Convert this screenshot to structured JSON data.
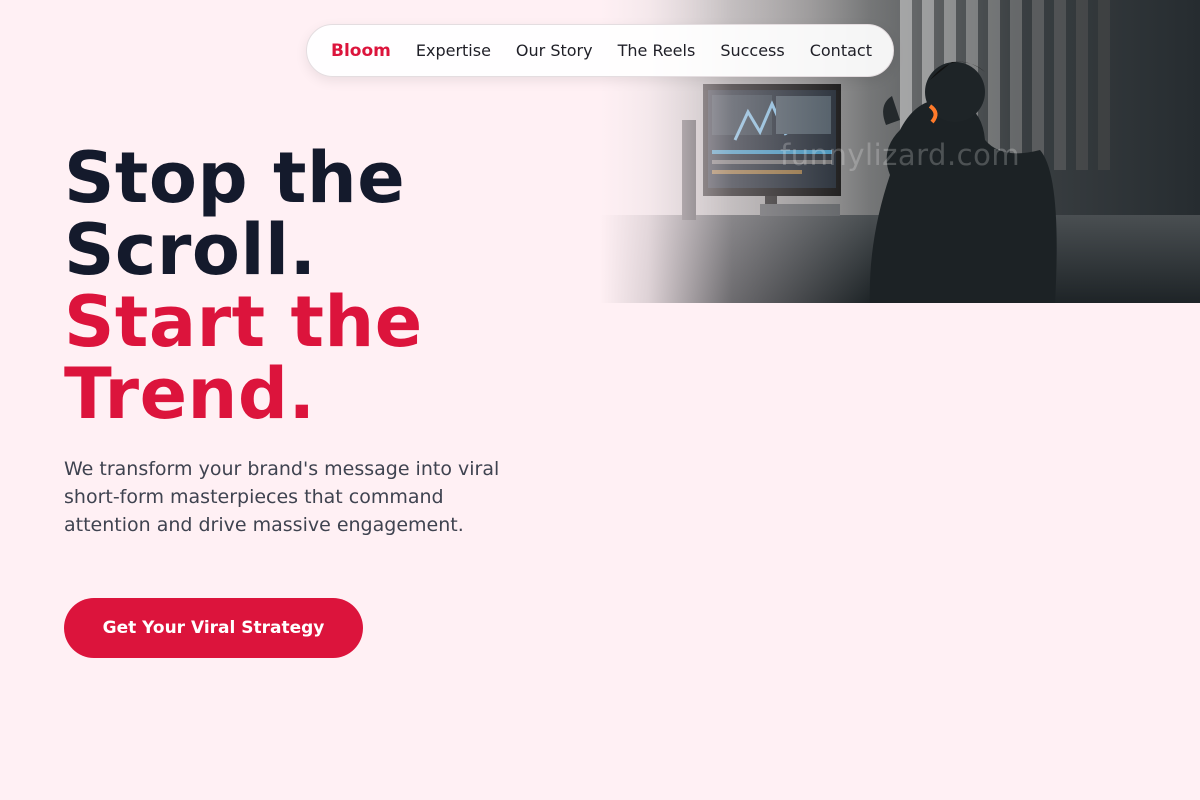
{
  "nav": {
    "brand": "Bloom",
    "links": [
      "Expertise",
      "Our Story",
      "The Reels",
      "Success",
      "Contact"
    ]
  },
  "hero": {
    "headline_line1": "Stop the",
    "headline_line2": "Scroll.",
    "headline_line3": "Start the",
    "headline_line4": "Trend.",
    "subtext": "We transform your brand's message into viral short-form masterpieces that command attention and drive massive engagement.",
    "cta_label": "Get Your Viral Strategy",
    "image_watermark": "funnylizard.com"
  },
  "colors": {
    "accent": "#dc143c",
    "background": "#fff0f4",
    "headline_dark": "#141a2c"
  }
}
